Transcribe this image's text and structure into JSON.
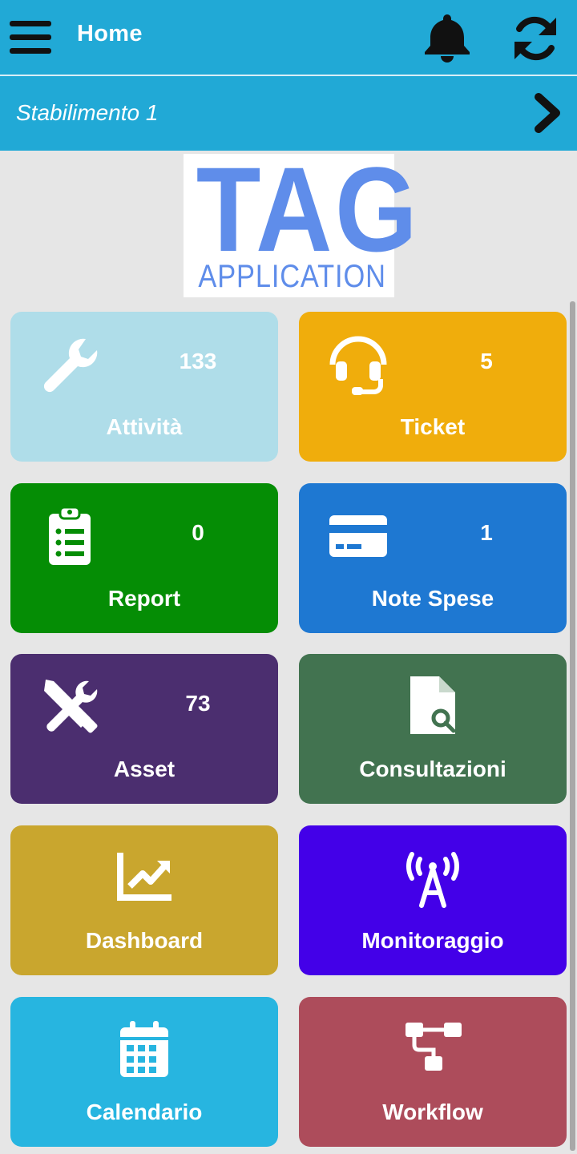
{
  "header": {
    "title": "Home",
    "menu_icon": "hamburger-icon",
    "notification_icon": "bell-icon",
    "refresh_icon": "refresh-icon",
    "bar_color": "#21a9d6"
  },
  "plant_selector": {
    "label": "Stabilimento 1",
    "icon": "chevron-right-icon"
  },
  "logo": {
    "line1": "TAG",
    "line2": "APPLICATION",
    "color": "#5f8dea"
  },
  "tiles": [
    {
      "label": "Attività",
      "count": "133",
      "icon": "wrench-icon",
      "color": "#afdde9"
    },
    {
      "label": "Ticket",
      "count": "5",
      "icon": "headset-icon",
      "color": "#f0ad0c"
    },
    {
      "label": "Report",
      "count": "0",
      "icon": "clipboard-list-icon",
      "color": "#058d05"
    },
    {
      "label": "Note Spese",
      "count": "1",
      "icon": "credit-card-icon",
      "color": "#1e78d2"
    },
    {
      "label": "Asset",
      "count": "73",
      "icon": "tools-icon",
      "color": "#4b2e6f"
    },
    {
      "label": "Consultazioni",
      "count": "",
      "icon": "file-search-icon",
      "color": "#427350"
    },
    {
      "label": "Dashboard",
      "count": "",
      "icon": "chart-line-icon",
      "color": "#c9a62e"
    },
    {
      "label": "Monitoraggio",
      "count": "",
      "icon": "broadcast-tower-icon",
      "color": "#4300e8"
    },
    {
      "label": "Calendario",
      "count": "",
      "icon": "calendar-icon",
      "color": "#27b5e0"
    },
    {
      "label": "Workflow",
      "count": "",
      "icon": "sitemap-icon",
      "color": "#ad4c5b"
    }
  ]
}
